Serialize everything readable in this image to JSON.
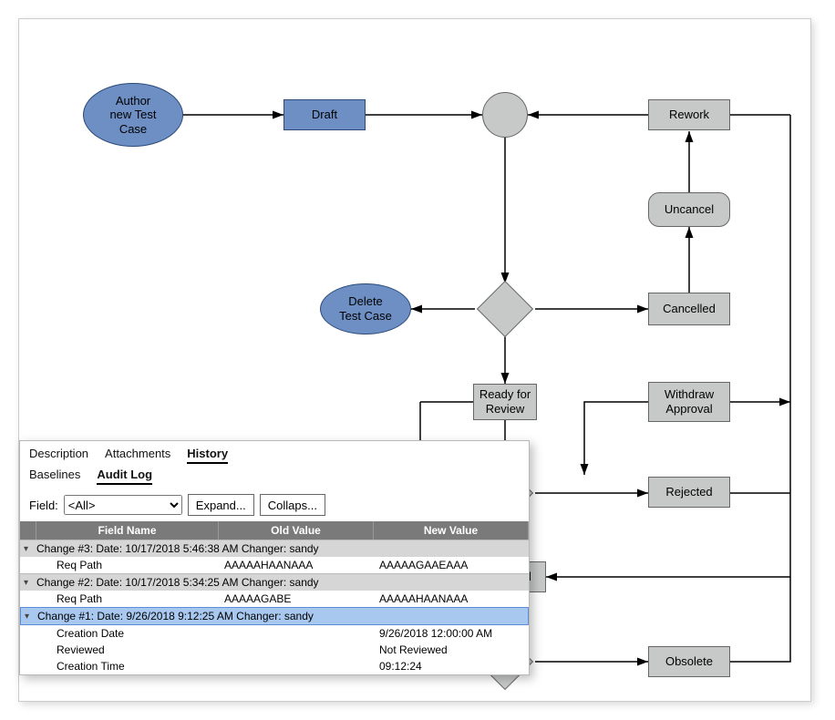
{
  "flowchart": {
    "nodes": {
      "author": "Author\nnew Test\nCase",
      "draft": "Draft",
      "rework": "Rework",
      "uncancel": "Uncancel",
      "cancelled": "Cancelled",
      "delete": "Delete\nTest Case",
      "ready": "Ready for\nReview",
      "withdraw": "Withdraw\nApproval",
      "rejected": "Rejected",
      "approved": "Approved",
      "obsolete": "Obsolete"
    }
  },
  "audit": {
    "tabs": {
      "top": [
        "Description",
        "Attachments",
        "History"
      ],
      "top_active": "History",
      "sub": [
        "Baselines",
        "Audit Log"
      ],
      "sub_active": "Audit Log"
    },
    "field_label": "Field:",
    "field_select_value": "<All>",
    "expand_btn": "Expand...",
    "collapse_btn": "Collaps...",
    "columns": {
      "field_name": "Field Name",
      "old_value": "Old Value",
      "new_value": "New Value"
    },
    "changes": [
      {
        "header": "Change #3: Date: 10/17/2018 5:46:38 AM  Changer: sandy",
        "selected": false,
        "rows": [
          {
            "field": "Req Path",
            "old": "AAAAAHAANAAA",
            "new": "AAAAAGAAEAAA"
          }
        ]
      },
      {
        "header": "Change #2: Date: 10/17/2018 5:34:25 AM  Changer: sandy",
        "selected": false,
        "rows": [
          {
            "field": "Req Path",
            "old": "AAAAAGABE",
            "new": "AAAAAHAANAAA"
          }
        ]
      },
      {
        "header": "Change #1: Date: 9/26/2018 9:12:25 AM  Changer: sandy",
        "selected": true,
        "rows": [
          {
            "field": "Creation Date",
            "old": "",
            "new": "9/26/2018 12:00:00 AM"
          },
          {
            "field": "Reviewed",
            "old": "",
            "new": "Not Reviewed"
          },
          {
            "field": "Creation Time",
            "old": "",
            "new": "09:12:24"
          }
        ]
      }
    ]
  }
}
